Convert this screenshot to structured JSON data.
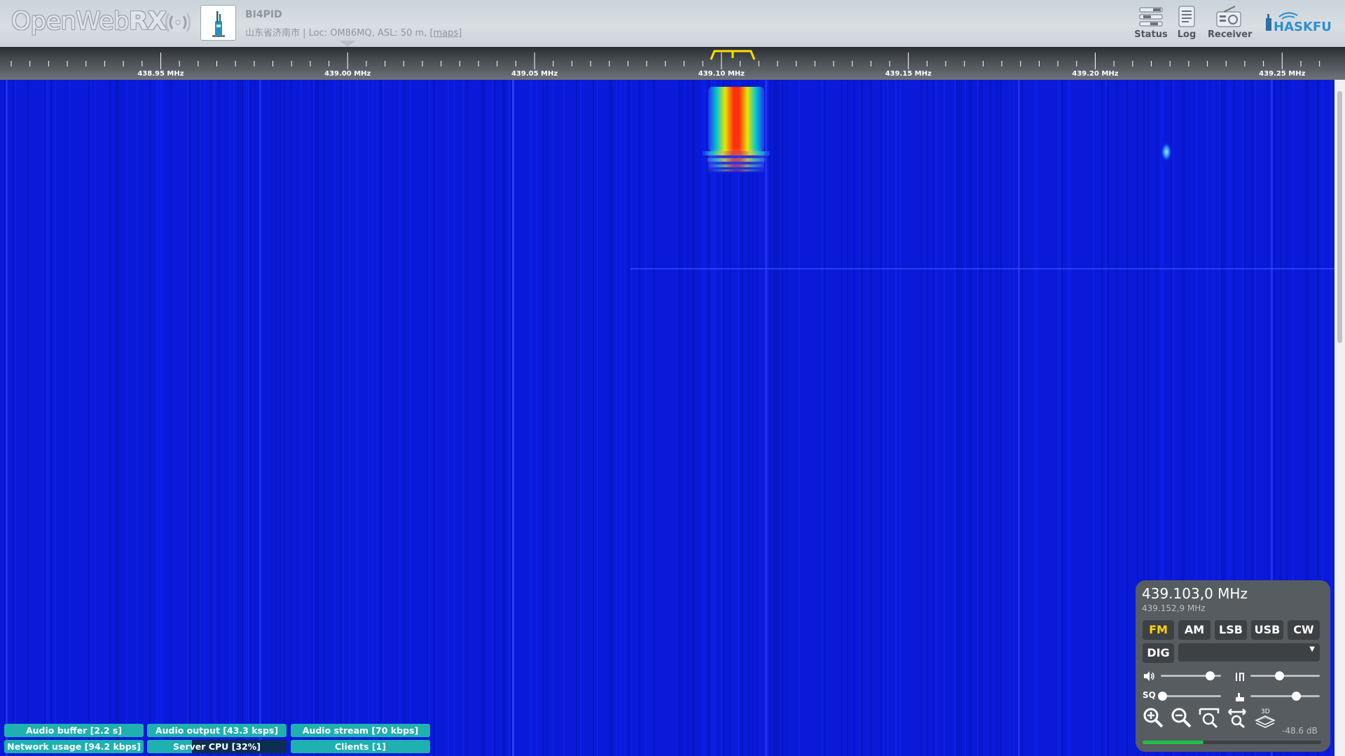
{
  "header": {
    "logo_text_light": "OpenWeb",
    "logo_text_bold": "RX",
    "callsign": "BI4PID",
    "location_text": "山东省济南市 | Loc: OM86MQ, ASL: 50 m, ",
    "maps_link": "[maps]",
    "buttons": {
      "status": "Status",
      "log": "Log",
      "receiver": "Receiver"
    },
    "partner_logo": "HASKFU",
    "icons": [
      "waves-icon",
      "avatar-icon",
      "status-icon",
      "log-icon",
      "receiver-icon"
    ]
  },
  "scale": {
    "labels": [
      "438.95 MHz",
      "439.00 MHz",
      "439.05 MHz",
      "439.10 MHz",
      "439.15 MHz",
      "439.20 MHz",
      "439.25 MHz"
    ],
    "label_values_mhz": [
      438.95,
      439.0,
      439.05,
      439.1,
      439.15,
      439.2,
      439.25
    ],
    "visible_range_mhz": [
      438.907,
      439.264
    ],
    "tuned_mhz": 439.103,
    "marker_color": "#ffde00"
  },
  "status_bars": {
    "audio_buffer": {
      "label": "Audio buffer [2.2 s]",
      "fill": 1.0
    },
    "audio_output": {
      "label": "Audio output [43.3 ksps]",
      "fill": 1.0
    },
    "audio_stream": {
      "label": "Audio stream [70 kbps]",
      "fill": 1.0
    },
    "network": {
      "label": "Network usage [94.2 kbps]",
      "fill": 1.0
    },
    "cpu": {
      "label": "Server CPU [32%]",
      "fill": 0.32
    },
    "clients": {
      "label": "Clients [1]",
      "fill": 1.0
    }
  },
  "receiver": {
    "frequency": "439.103,0 MHz",
    "sub_frequency": "439.152,9 MHz",
    "modes": [
      "FM",
      "AM",
      "LSB",
      "USB",
      "CW"
    ],
    "active_mode": "FM",
    "dig_label": "DIG",
    "dig_selected": "",
    "volume_level": 0.82,
    "squelch_level": 0.03,
    "waterfall_max_level": 0.42,
    "waterfall_min_level": 0.66,
    "squelch_label": "SQ",
    "db_readout": "-48.6 dB",
    "smeter_level": 0.34,
    "accent_color": "#ffd400",
    "tools": [
      "zoom-in-icon",
      "zoom-out-icon",
      "zoom-reset-icon",
      "zoom-fit-icon",
      "3d-icon"
    ]
  },
  "colors": {
    "waterfall_bg": "#0a1ad8",
    "status_fill": "#1fb0b0",
    "status_bg": "#0c2e4f",
    "panel_bg": "#575c60"
  }
}
